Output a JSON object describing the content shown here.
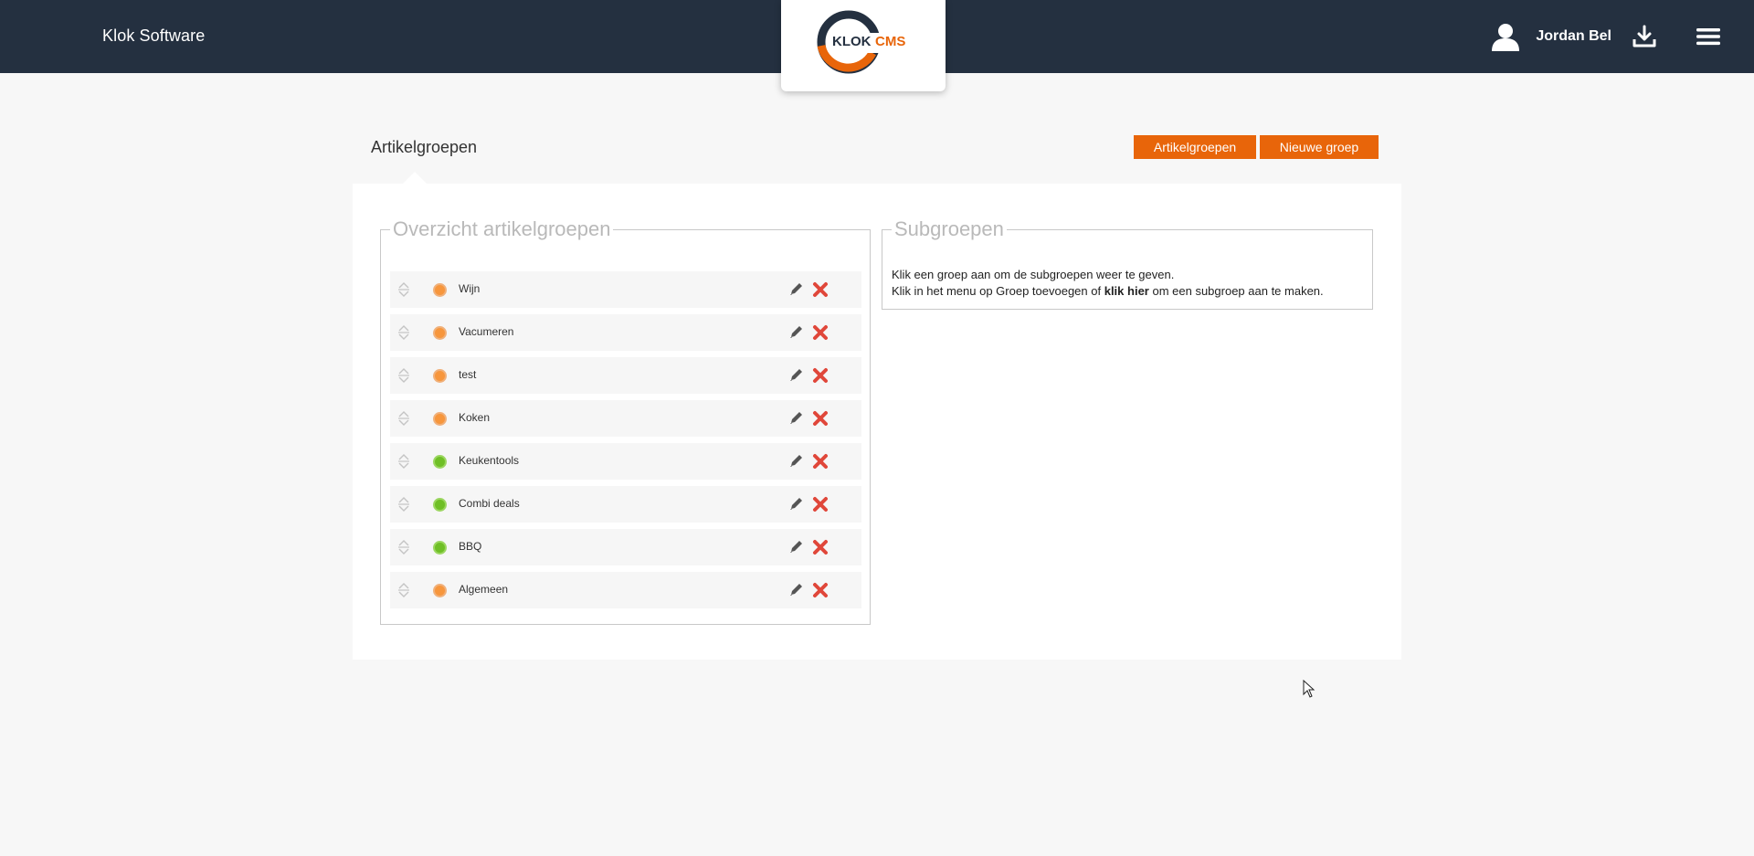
{
  "header": {
    "brand": "Klok Software",
    "logo": {
      "word1": "KLOK",
      "word2": "CMS"
    },
    "user_name": "Jordan Bel",
    "icons": {
      "user": "user-icon",
      "download": "download-icon",
      "menu": "hamburger-menu-icon"
    }
  },
  "page": {
    "title": "Artikelgroepen",
    "buttons": {
      "groups": "Artikelgroepen",
      "new_group": "Nieuwe groep"
    }
  },
  "overview": {
    "legend": "Overzicht artikelgroepen",
    "items": [
      {
        "label": "Wijn",
        "status": "orange"
      },
      {
        "label": "Vacumeren",
        "status": "orange"
      },
      {
        "label": "test",
        "status": "orange"
      },
      {
        "label": "Koken",
        "status": "orange"
      },
      {
        "label": "Keukentools",
        "status": "green"
      },
      {
        "label": "Combi deals",
        "status": "green"
      },
      {
        "label": "BBQ",
        "status": "green"
      },
      {
        "label": "Algemeen",
        "status": "orange"
      }
    ]
  },
  "subgroups": {
    "legend": "Subgroepen",
    "line1": "Klik een groep aan om de subgroepen weer te geven.",
    "line2_pre": "Klik in het menu op Groep toevoegen of ",
    "line2_link": "klik hier",
    "line2_post": " om een subgroep aan te maken."
  },
  "colors": {
    "header_bg": "#243040",
    "accent": "#e8650a",
    "status_orange": "#f7963c",
    "status_green": "#6fbf26",
    "delete_red": "#e0473a"
  }
}
